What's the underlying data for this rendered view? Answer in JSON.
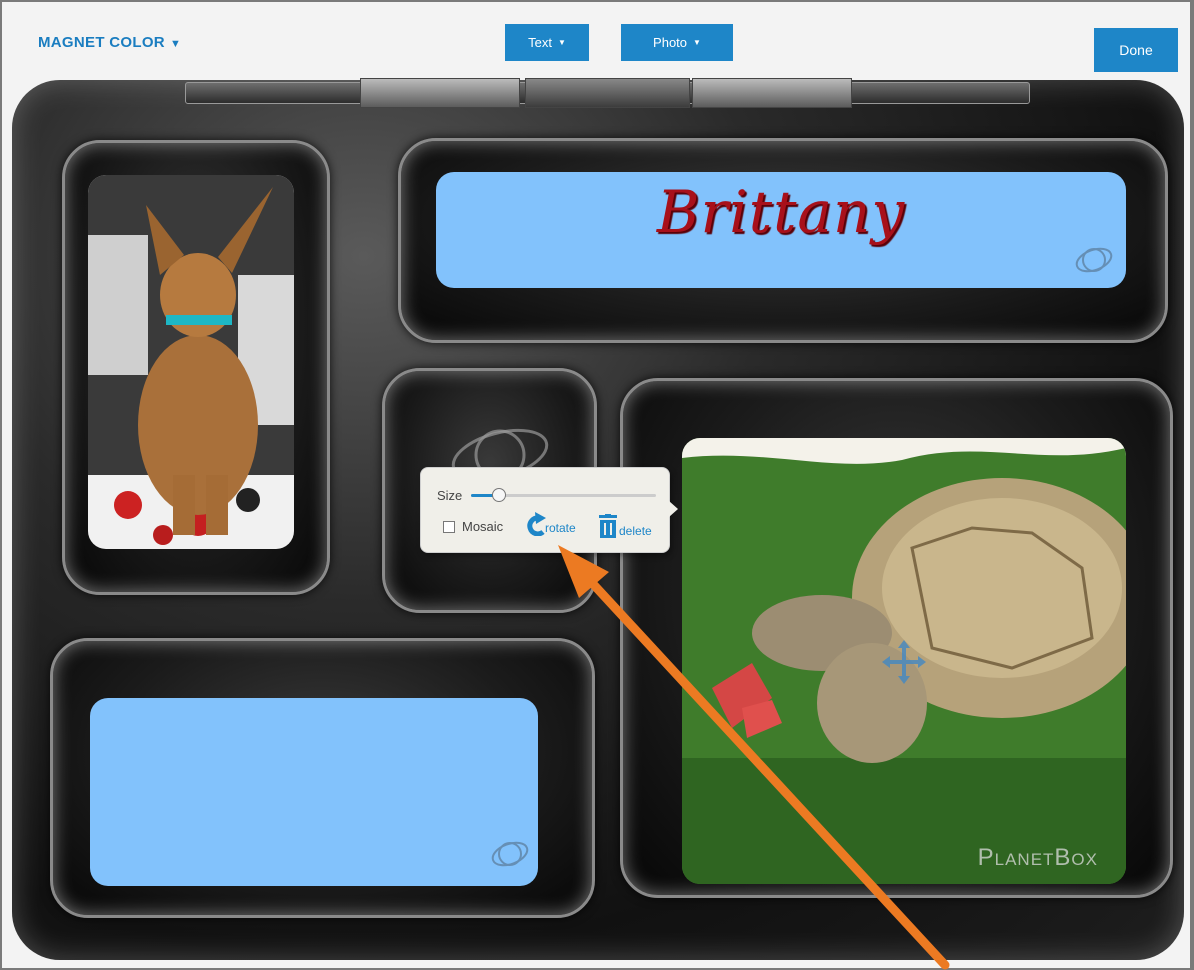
{
  "toolbar": {
    "magnet_label": "MAGNET COLOR",
    "text_label": "Text",
    "photo_label": "Photo",
    "done_label": "Done",
    "caret": "▼"
  },
  "magnets": {
    "name_text": "Brittany",
    "watermark": "PlanetBox"
  },
  "popup": {
    "size_label": "Size",
    "size_value_percent": 15,
    "mosaic_label": "Mosaic",
    "mosaic_checked": false,
    "rotate_label": "rotate",
    "delete_label": "delete"
  },
  "icons": {
    "dropdown": "caret-down-icon",
    "rotate": "rotate-icon",
    "delete": "trash-icon",
    "move": "move-icon",
    "planet": "planet-icon"
  },
  "colors": {
    "accent": "#1e86c8",
    "magnet_blue": "#82c2fc",
    "name_text": "#a8101a",
    "annotation_arrow": "#ec7a22"
  }
}
